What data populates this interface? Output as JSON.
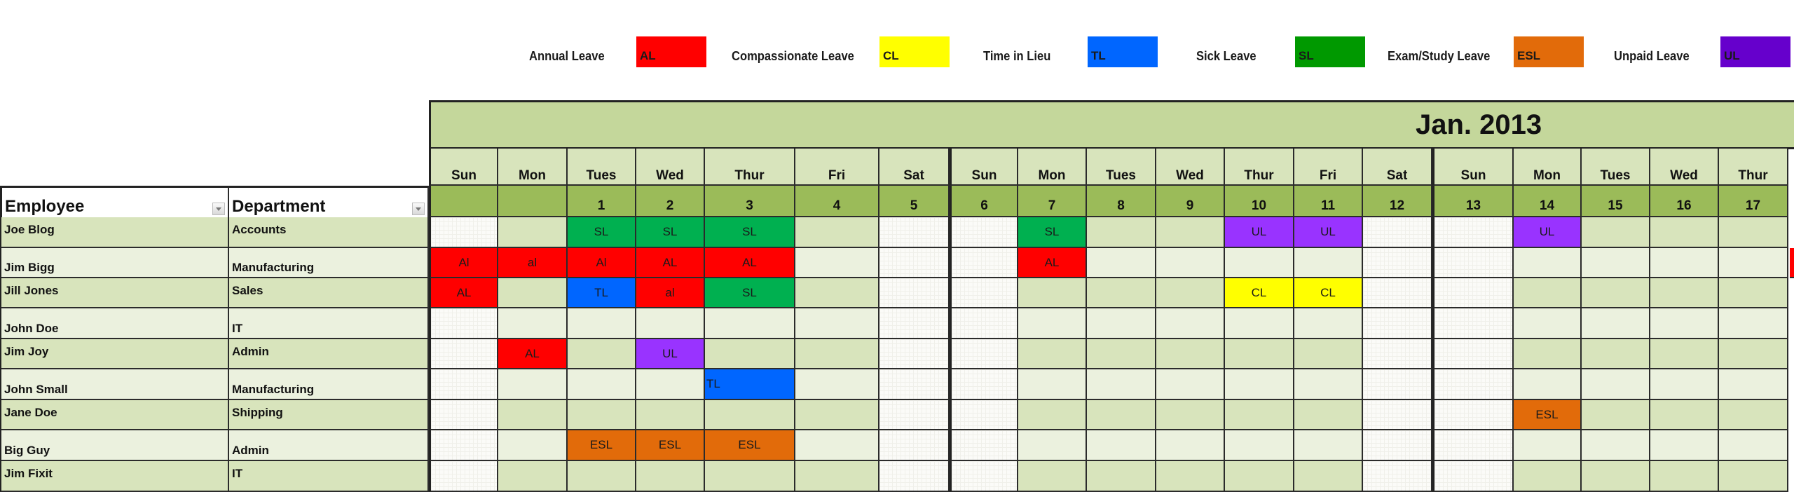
{
  "legend": [
    {
      "label": "Annual Leave",
      "code": "AL",
      "color": "#ff0000"
    },
    {
      "label": "Compassionate Leave",
      "code": "CL",
      "color": "#ffff00"
    },
    {
      "label": "Time in Lieu",
      "code": "TL",
      "color": "#0066ff"
    },
    {
      "label": "Sick Leave",
      "code": "SL",
      "color": "#009900"
    },
    {
      "label": "Exam/Study Leave",
      "code": "ESL",
      "color": "#e26b0a"
    },
    {
      "label": "Unpaid Leave",
      "code": "UL",
      "color": "#6600cc"
    }
  ],
  "cell_colors": {
    "AL": "#ff0000",
    "CL": "#ffff00",
    "TL": "#0066ff",
    "SL": "#00b050",
    "ESL": "#e26b0a",
    "UL": "#9933ff"
  },
  "month_title": "Jan. 2013",
  "headers": {
    "employee": "Employee",
    "department": "Department"
  },
  "days": [
    {
      "weekday": "Sun",
      "date": "",
      "weekend": true
    },
    {
      "weekday": "Mon",
      "date": "",
      "weekend": false
    },
    {
      "weekday": "Tues",
      "date": "1",
      "weekend": false
    },
    {
      "weekday": "Wed",
      "date": "2",
      "weekend": false
    },
    {
      "weekday": "Thur",
      "date": "3",
      "weekend": false
    },
    {
      "weekday": "Fri",
      "date": "4",
      "weekend": false
    },
    {
      "weekday": "Sat",
      "date": "5",
      "weekend": true
    },
    {
      "weekday": "Sun",
      "date": "6",
      "weekend": true
    },
    {
      "weekday": "Mon",
      "date": "7",
      "weekend": false
    },
    {
      "weekday": "Tues",
      "date": "8",
      "weekend": false
    },
    {
      "weekday": "Wed",
      "date": "9",
      "weekend": false
    },
    {
      "weekday": "Thur",
      "date": "10",
      "weekend": false
    },
    {
      "weekday": "Fri",
      "date": "11",
      "weekend": false
    },
    {
      "weekday": "Sat",
      "date": "12",
      "weekend": true
    },
    {
      "weekday": "Sun",
      "date": "13",
      "weekend": true
    },
    {
      "weekday": "Mon",
      "date": "14",
      "weekend": false
    },
    {
      "weekday": "Tues",
      "date": "15",
      "weekend": false
    },
    {
      "weekday": "Wed",
      "date": "16",
      "weekend": false
    },
    {
      "weekday": "Thur",
      "date": "17",
      "weekend": false
    }
  ],
  "employees": [
    {
      "name": "Joe Blog",
      "department": "Accounts",
      "leave": {
        "2": "SL",
        "3": "SL",
        "4": "SL",
        "8": "SL",
        "11": "UL",
        "12": "UL",
        "15": "UL"
      }
    },
    {
      "name": "Jim Bigg",
      "department": "Manufacturing",
      "leave": {
        "0": "Al",
        "1": "al",
        "2": "Al",
        "3": "AL",
        "4": "AL",
        "8": "AL"
      },
      "overflow_right": "AL"
    },
    {
      "name": "Jill Jones",
      "department": "Sales",
      "leave": {
        "0": "AL",
        "2": "TL",
        "3": "al",
        "4": "SL",
        "11": "CL",
        "12": "CL"
      }
    },
    {
      "name": "John Doe",
      "department": "IT",
      "leave": {}
    },
    {
      "name": "Jim Joy",
      "department": "Admin",
      "leave": {
        "1": "AL",
        "3": "UL"
      }
    },
    {
      "name": "John Small",
      "department": "Manufacturing",
      "leave": {
        "4": "TL"
      }
    },
    {
      "name": "Jane Doe",
      "department": "Shipping",
      "leave": {
        "15": "ESL"
      }
    },
    {
      "name": "Big Guy",
      "department": "Admin",
      "leave": {
        "2": "ESL",
        "3": "ESL",
        "4": "ESL"
      }
    },
    {
      "name": "Jim Fixit",
      "department": "IT",
      "leave": {}
    }
  ]
}
